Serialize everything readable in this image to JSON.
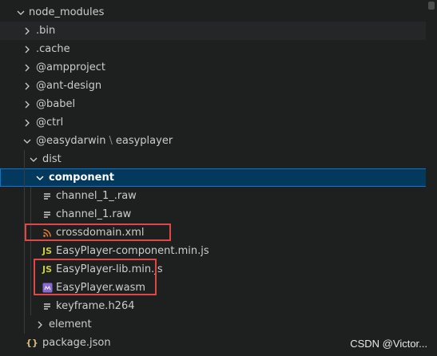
{
  "tree": {
    "node_modules": "node_modules",
    "bin": ".bin",
    "cache": ".cache",
    "ampproject": "@ampproject",
    "ant_design": "@ant-design",
    "babel": "@babel",
    "ctrl": "@ctrl",
    "easydarwin": "@easydarwin",
    "easyplayer": "easyplayer",
    "dist": "dist",
    "component": "component",
    "files": [
      {
        "name": "channel_1_.raw",
        "icon": "text-file-icon"
      },
      {
        "name": "channel_1.raw",
        "icon": "text-file-icon"
      },
      {
        "name": "crossdomain.xml",
        "icon": "rss-icon"
      },
      {
        "name": "EasyPlayer-component.min.js",
        "icon": "js-icon",
        "badge": "JS"
      },
      {
        "name": "EasyPlayer-lib.min.js",
        "icon": "js-icon",
        "badge": "JS"
      },
      {
        "name": "EasyPlayer.wasm",
        "icon": "wasm-icon"
      },
      {
        "name": "keyframe.h264",
        "icon": "text-file-icon"
      }
    ],
    "element": "element",
    "package_json": "package.json",
    "package_json_icon": "{}"
  },
  "watermark": "CSDN @Victor...",
  "colors": {
    "selection": "#04395e",
    "focus_border": "#0078d4",
    "highlight_box": "#e04848",
    "js_yellow": "#cbcb41",
    "rss_orange": "#e37933",
    "wasm_purple": "#8b68d8",
    "json_yellow": "#d7ba7d"
  }
}
